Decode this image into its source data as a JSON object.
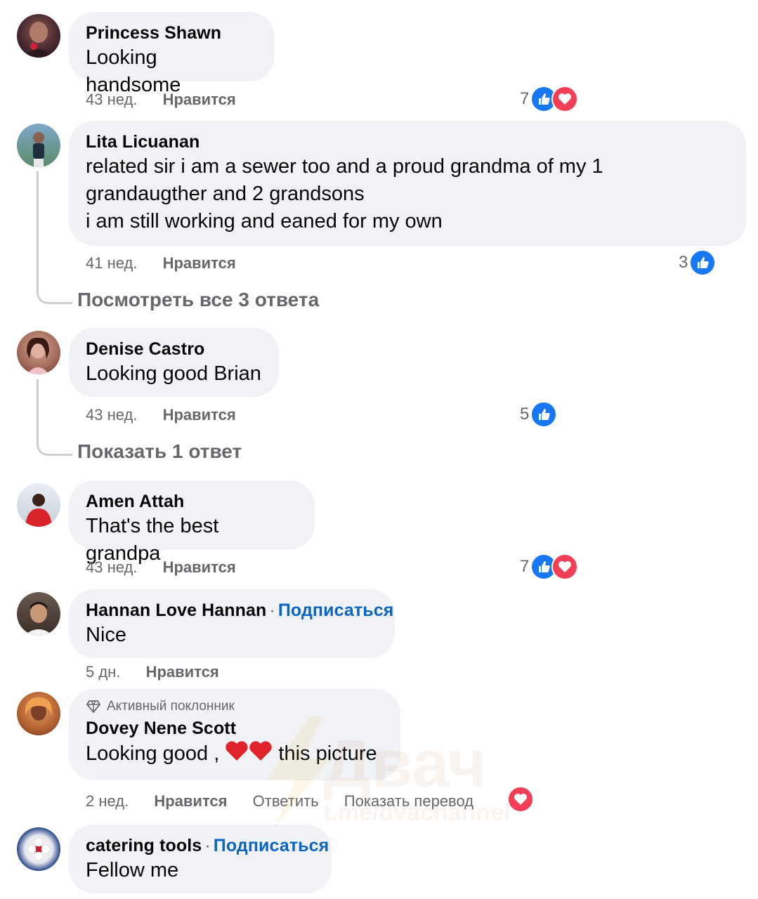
{
  "comments": [
    {
      "name": "Princess Shawn",
      "text": "Looking handsome",
      "time": "43 нед.",
      "like": "Нравится",
      "reaction_count": "7"
    },
    {
      "name": "Lita Licuanan",
      "text": "related sir i am a sewer too and a proud grandma of my 1\ngrandaugther and 2 grandsons\ni am still working and eaned for my own",
      "time": "41 нед.",
      "like": "Нравится",
      "reaction_count": "3",
      "replies": "Посмотреть все 3 ответа"
    },
    {
      "name": "Denise Castro",
      "text": "Looking good Brian",
      "time": "43 нед.",
      "like": "Нравится",
      "reaction_count": "5",
      "replies": "Показать 1 ответ"
    },
    {
      "name": "Amen Attah",
      "text": "That's the best grandpa",
      "time": "43 нед.",
      "like": "Нравится",
      "reaction_count": "7"
    },
    {
      "name": "Hannan Love Hannan",
      "follow": "Подписаться",
      "text": "Nice",
      "time": "5 дн.",
      "like": "Нравится"
    },
    {
      "badge": "Активный поклонник",
      "name": "Dovey Nene Scott",
      "text_before": "Looking good ,",
      "text_after": "this picture",
      "time": "2 нед.",
      "like": "Нравится",
      "reply": "Ответить",
      "translate": "Показать перевод"
    },
    {
      "name": "catering tools",
      "follow": "Подписаться",
      "text": "Fellow me"
    }
  ],
  "watermark": {
    "title": "Двач",
    "subtitle": "t.me/dvachannel"
  },
  "colors": {
    "like": "#1877f2",
    "love": "#f33e58",
    "link": "#0a66c2",
    "bubble": "#f0f2f5",
    "meta": "#65676b"
  }
}
